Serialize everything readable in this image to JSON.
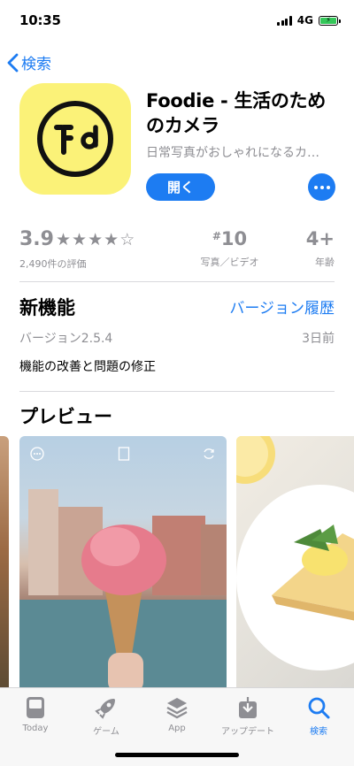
{
  "status_bar": {
    "time": "10:35",
    "network": "4G"
  },
  "nav": {
    "back_label": "検索"
  },
  "app": {
    "title": "Foodie - 生活のためのカメラ",
    "subtitle": "日常写真がおしゃれになるカ…",
    "open_label": "開く",
    "icon_color": "#fbf278"
  },
  "stats": {
    "rating": "3.9",
    "stars_filled": 4,
    "stars_total": 5,
    "rating_count": "2,490件の評価",
    "rank_prefix": "#",
    "rank": "10",
    "rank_category": "写真／ビデオ",
    "age": "4+",
    "age_label": "年齢"
  },
  "whats_new": {
    "title": "新機能",
    "history_link": "バージョン履歴",
    "version": "バージョン2.5.4",
    "date": "3日前",
    "notes": "機能の改善と問題の修正"
  },
  "preview": {
    "title": "プレビュー"
  },
  "tab_bar": {
    "items": [
      {
        "label": "Today",
        "icon": "today-icon"
      },
      {
        "label": "ゲーム",
        "icon": "rocket-icon"
      },
      {
        "label": "App",
        "icon": "layers-icon"
      },
      {
        "label": "アップデート",
        "icon": "download-icon"
      },
      {
        "label": "検索",
        "icon": "search-icon"
      }
    ],
    "active_index": 4
  },
  "colors": {
    "accent": "#1d7cf2",
    "secondary_text": "#8e8e93"
  }
}
